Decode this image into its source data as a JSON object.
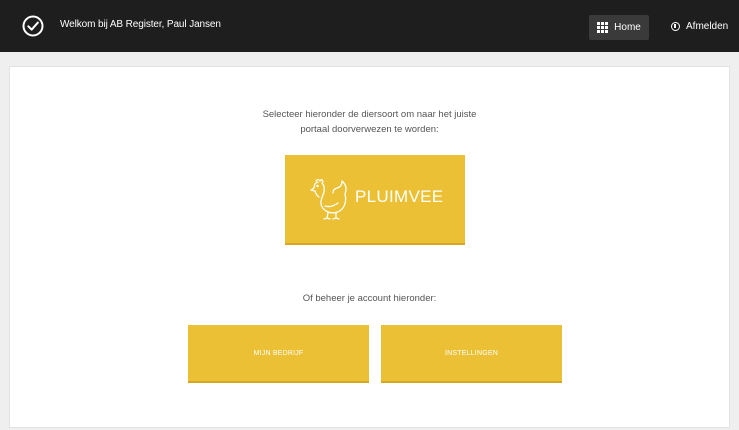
{
  "header": {
    "welcome_text": "Welkom bij AB Register, Paul Jansen",
    "home_label": "Home",
    "logout_label": "Afmelden"
  },
  "main": {
    "intro_line1": "Selecteer hieronder de diersoort om naar het juiste",
    "intro_line2": "portaal doorverwezen te worden:",
    "species_button_label": "PLUIMVEE",
    "account_intro": "Of beheer je account hieronder:",
    "account_buttons": [
      {
        "label": "MIJN BEDRIJF"
      },
      {
        "label": "INSTELLINGEN"
      }
    ]
  },
  "icons": {
    "logo": "checkmark-circle-icon",
    "home": "grid-icon",
    "logout": "power-icon",
    "species": "chicken-icon"
  },
  "colors": {
    "topbar": "#1e1e1e",
    "accent_yellow": "#ecc034",
    "page_background": "#efefef"
  }
}
